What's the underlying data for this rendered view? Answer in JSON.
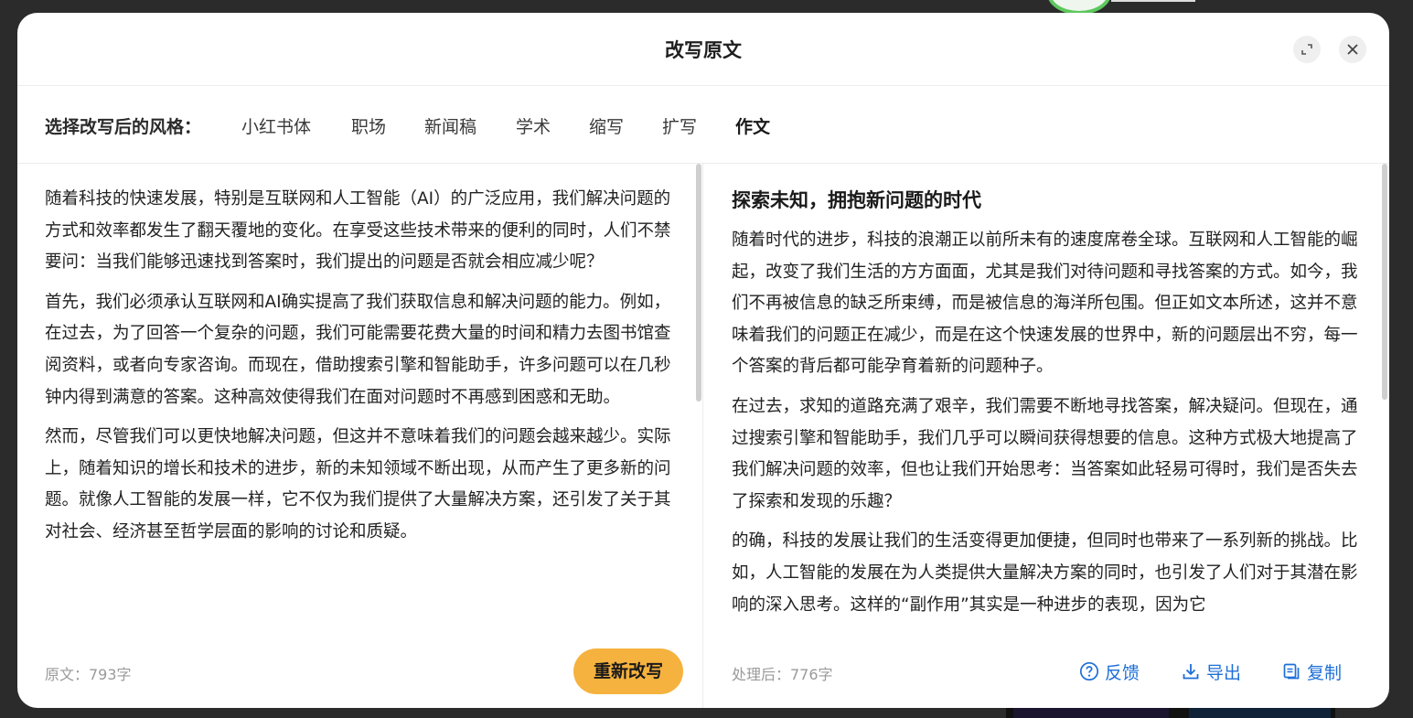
{
  "modal": {
    "title": "改写原文",
    "expand_icon": "expand-icon",
    "close_icon": "close-icon"
  },
  "style_bar": {
    "label": "选择改写后的风格：",
    "tabs": [
      {
        "label": "小红书体",
        "active": false
      },
      {
        "label": "职场",
        "active": false
      },
      {
        "label": "新闻稿",
        "active": false
      },
      {
        "label": "学术",
        "active": false
      },
      {
        "label": "缩写",
        "active": false
      },
      {
        "label": "扩写",
        "active": false
      },
      {
        "label": "作文",
        "active": true
      }
    ],
    "accent_color": "#f6a832"
  },
  "original": {
    "paragraphs": [
      "随着科技的快速发展，特别是互联网和人工智能（AI）的广泛应用，我们解决问题的方式和效率都发生了翻天覆地的变化。在享受这些技术带来的便利的同时，人们不禁要问：当我们能够迅速找到答案时，我们提出的问题是否就会相应减少呢？",
      "首先，我们必须承认互联网和AI确实提高了我们获取信息和解决问题的能力。例如，在过去，为了回答一个复杂的问题，我们可能需要花费大量的时间和精力去图书馆查阅资料，或者向专家咨询。而现在，借助搜索引擎和智能助手，许多问题可以在几秒钟内得到满意的答案。这种高效使得我们在面对问题时不再感到困惑和无助。",
      "然而，尽管我们可以更快地解决问题，但这并不意味着我们的问题会越来越少。实际上，随着知识的增长和技术的进步，新的未知领域不断出现，从而产生了更多新的问题。就像人工智能的发展一样，它不仅为我们提供了大量解决方案，还引发了关于其对社会、经济甚至哲学层面的影响的讨论和质疑。"
    ],
    "count_label": "原文：793字",
    "regen_button": "重新改写"
  },
  "rewritten": {
    "title": "探索未知，拥抱新问题的时代",
    "paragraphs": [
      "随着时代的进步，科技的浪潮正以前所未有的速度席卷全球。互联网和人工智能的崛起，改变了我们生活的方方面面，尤其是我们对待问题和寻找答案的方式。如今，我们不再被信息的缺乏所束缚，而是被信息的海洋所包围。但正如文本所述，这并不意味着我们的问题正在减少，而是在这个快速发展的世界中，新的问题层出不穷，每一个答案的背后都可能孕育着新的问题种子。",
      "在过去，求知的道路充满了艰辛，我们需要不断地寻找答案，解决疑问。但现在，通过搜索引擎和智能助手，我们几乎可以瞬间获得想要的信息。这种方式极大地提高了我们解决问题的效率，但也让我们开始思考：当答案如此轻易可得时，我们是否失去了探索和发现的乐趣？",
      "的确，科技的发展让我们的生活变得更加便捷，但同时也带来了一系列新的挑战。比如，人工智能的发展在为人类提供大量解决方案的同时，也引发了人们对于其潜在影响的深入思考。这样的“副作用”其实是一种进步的表现，因为它"
    ],
    "count_label": "处理后：776字",
    "actions": {
      "feedback": "反馈",
      "export": "导出",
      "copy": "复制"
    },
    "action_color": "#1e6fd8"
  }
}
